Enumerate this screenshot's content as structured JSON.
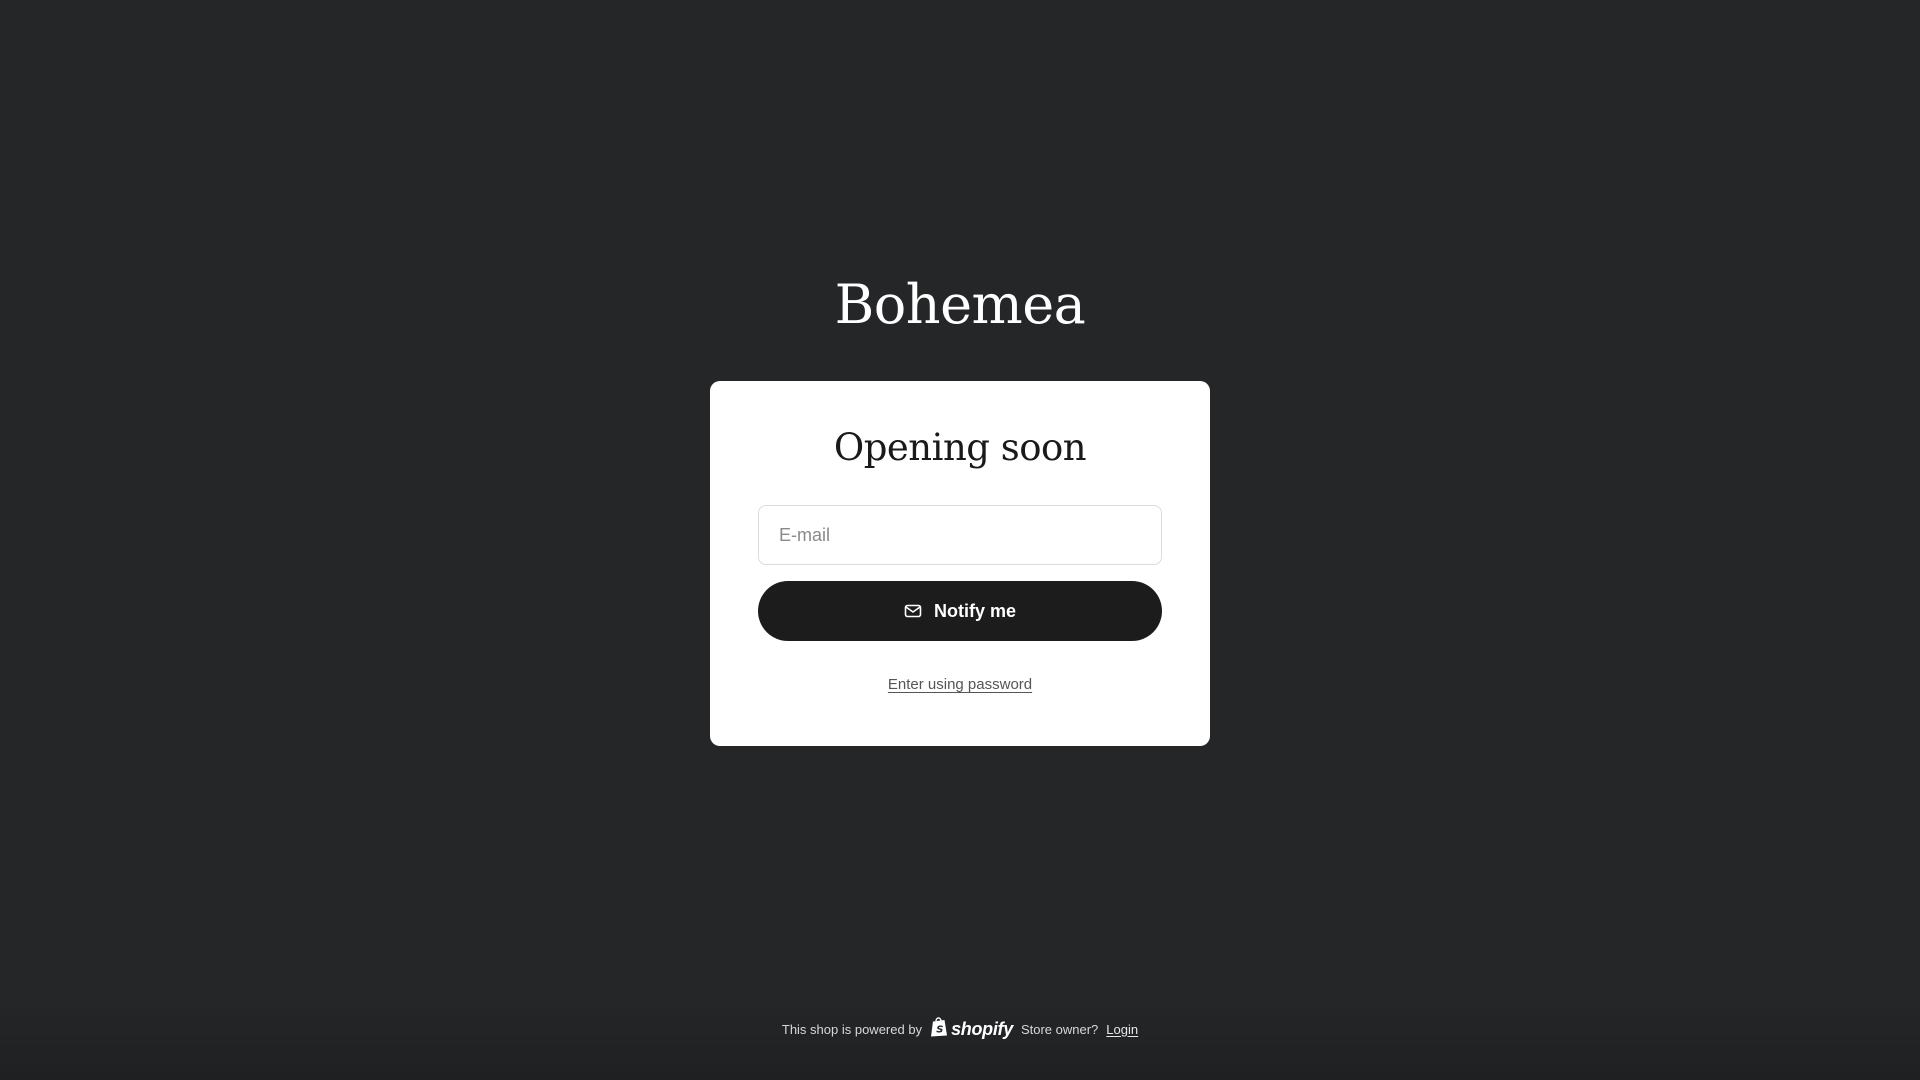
{
  "brand": {
    "name": "Bohemea"
  },
  "card": {
    "title": "Opening soon",
    "email_placeholder": "E-mail",
    "notify_label": "Notify me",
    "password_link": "Enter using password"
  },
  "footer": {
    "powered_text": "This shop is powered by",
    "shopify_logo_text": "shopify",
    "store_owner_text": "Store owner?",
    "login_label": "Login"
  },
  "icons": {
    "notify": "envelope-icon",
    "shopify": "shopify-bag-icon"
  },
  "colors": {
    "background": "#252628",
    "card": "#ffffff",
    "button": "#1c1c1c"
  }
}
